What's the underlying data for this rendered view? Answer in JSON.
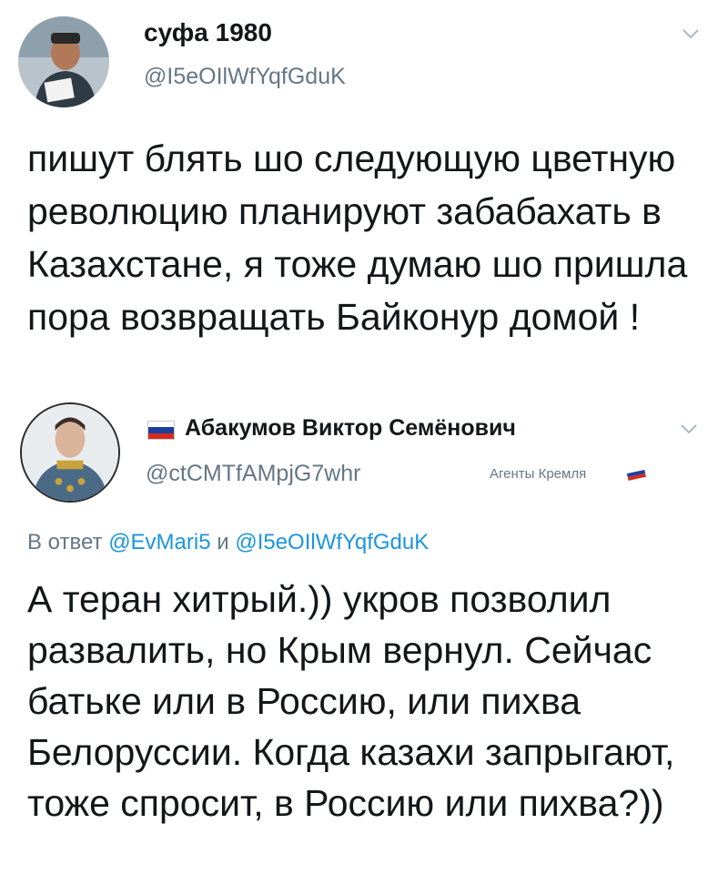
{
  "tweet1": {
    "display_name": "суфа 1980",
    "handle": "@I5eOIlWfYqfGduK",
    "text": "пишут блять шо следующую цветную революцию планируют забабахать в Казахстане, я тоже думаю шо пришла пора возвращать Байконур домой !",
    "avatar_icon": "user-avatar-man-reading"
  },
  "reply": {
    "display_name": "Абакумов Виктор Семёнович",
    "handle": "@ctCMTfAMpjG7whr",
    "badge": "Агенты Кремля",
    "reply_prefix": "В ответ",
    "reply_mention_1": "@EvMari5",
    "reply_conjunction": "и",
    "reply_mention_2": "@I5eOIlWfYqfGduK",
    "text": "А теран хитрый.)) укров позволил развалить, но Крым вернул. Сейчас батьке или в Россию, или пихва Белоруссии. Когда казахи запрыгают, тоже спросит, в Россию или пихва?))",
    "avatar_icon": "user-avatar-military-portrait",
    "flag_icon": "russia-flag-icon",
    "flag_colors": [
      "#ffffff",
      "#1c3f9e",
      "#d52b1e"
    ]
  },
  "colors": {
    "text": "#14171a",
    "secondary": "#657786",
    "link": "#1b95e0"
  }
}
